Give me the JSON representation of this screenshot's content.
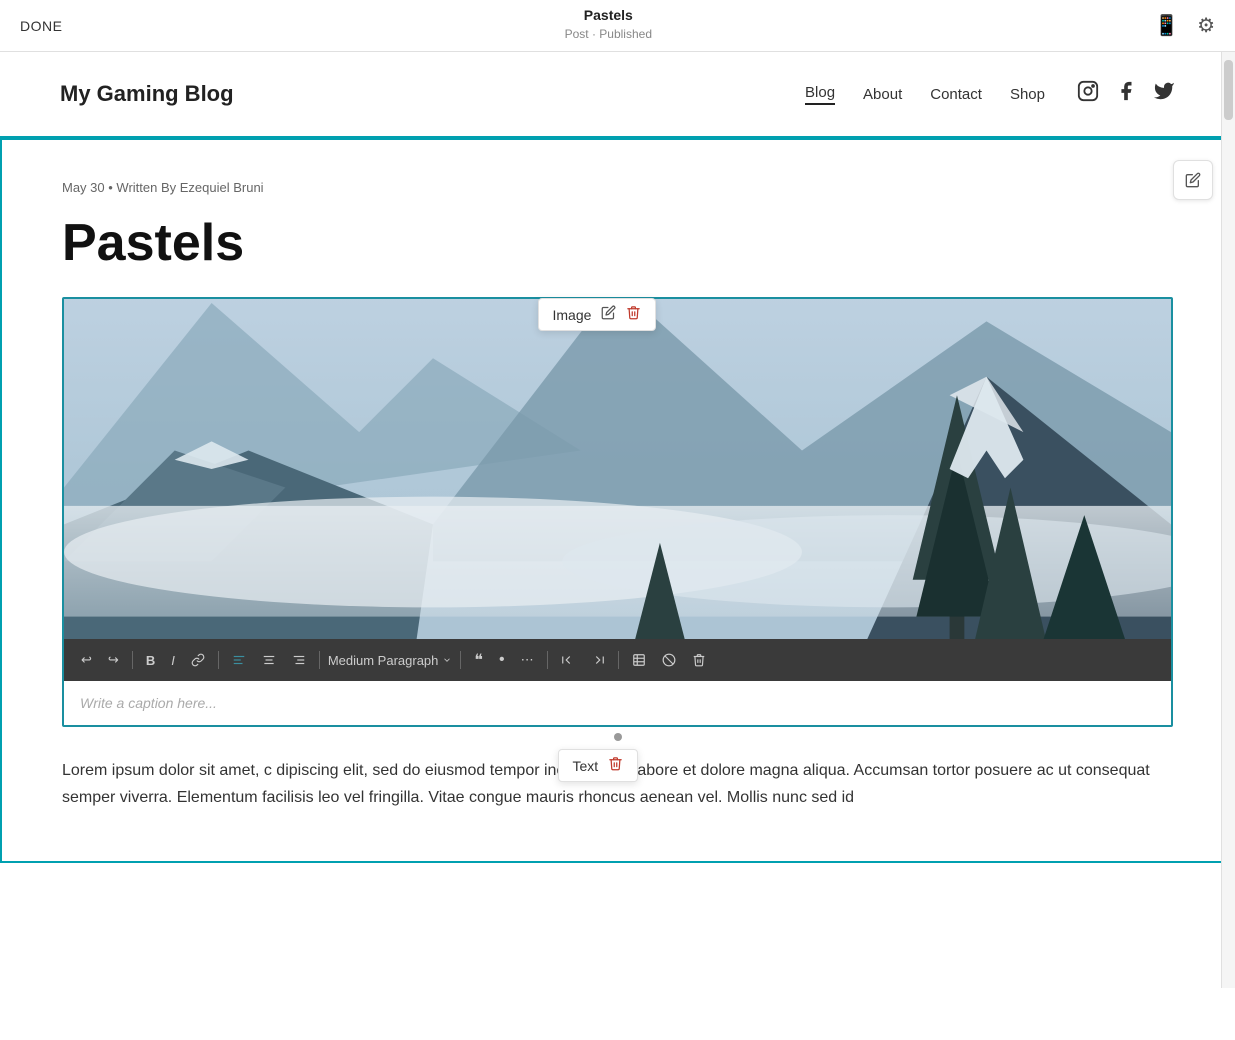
{
  "topbar": {
    "done_label": "DONE",
    "title": "Pastels",
    "subtitle": "Post · Published",
    "icon_mobile": "📱",
    "icon_settings": "⚙"
  },
  "site": {
    "title": "My Gaming Blog",
    "nav": [
      {
        "label": "Blog",
        "active": true
      },
      {
        "label": "About",
        "active": false
      },
      {
        "label": "Contact",
        "active": false
      },
      {
        "label": "Shop",
        "active": false
      }
    ],
    "social_instagram": "instagram-icon",
    "social_facebook": "facebook-icon",
    "social_twitter": "twitter-icon"
  },
  "post": {
    "meta": "May 30  •  Written By Ezequiel Bruni",
    "title": "Pastels",
    "image_label": "Image",
    "caption_placeholder": "Write a caption here...",
    "body_text": "Lorem ipsum dolor sit amet, c dipiscing elit, sed do eiusmod tempor incididunt ut labore et dolore magna aliqua. Accumsan tortor posuere ac ut consequat semper viverra. Elementum facilisis leo vel fringilla. Vitae congue mauris rhoncus aenean vel. Mollis nunc sed id"
  },
  "caption_toolbar": {
    "undo": "↩",
    "redo": "↪",
    "bold": "B",
    "italic": "I",
    "link": "🔗",
    "align_left": "≡",
    "align_center": "≡",
    "align_right": "≡",
    "paragraph_label": "Medium Paragraph",
    "quote": "❝",
    "bullet": "•",
    "more": "⋯",
    "outdent": "⇤",
    "indent": "⇥",
    "table": "⊞",
    "embed": "⊘",
    "delete_row": "🗑"
  },
  "text_inline_toolbar": {
    "label": "Text",
    "delete": "🗑"
  }
}
